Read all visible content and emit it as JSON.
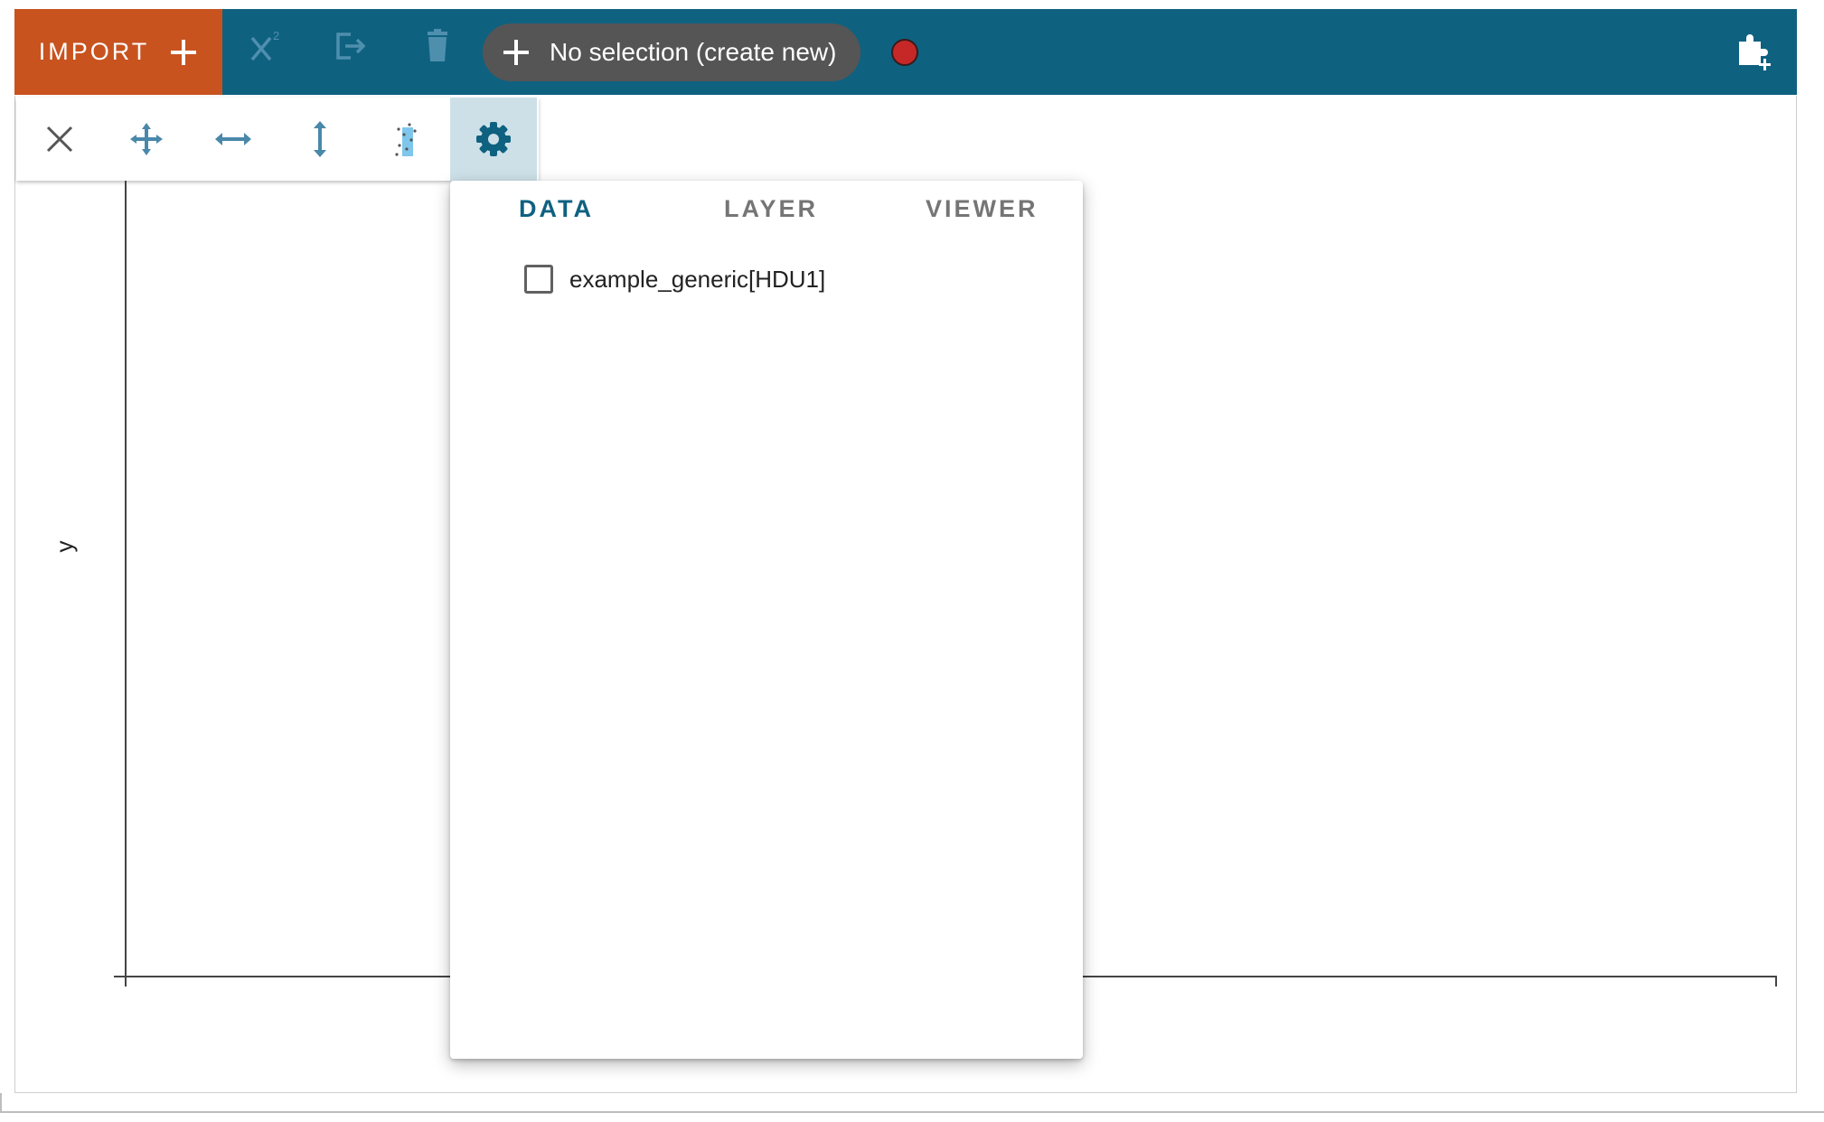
{
  "toolbar": {
    "import_label": "IMPORT",
    "selection_label": "No selection (create new)",
    "icons": [
      "add-icon",
      "chi-squared-icon",
      "export-icon",
      "delete-icon",
      "add-subset-icon",
      "record-icon",
      "add-plugin-icon"
    ],
    "colors": {
      "toolbar_bg": "#0f6180",
      "import_bg": "#c8531f",
      "pill_bg": "#555555",
      "record": "#c62828"
    }
  },
  "viewer_tools": {
    "items": [
      "close-icon",
      "pan-zoom-icon",
      "pan-x-icon",
      "pan-y-icon",
      "bqplot-select-icon",
      "settings-icon"
    ],
    "active": "settings-icon"
  },
  "plot": {
    "ylabel": "y"
  },
  "settings_popup": {
    "tabs": [
      "DATA",
      "LAYER",
      "VIEWER"
    ],
    "active_tab": "DATA",
    "data_items": [
      {
        "label": "example_generic[HDU1]",
        "checked": false
      }
    ]
  }
}
